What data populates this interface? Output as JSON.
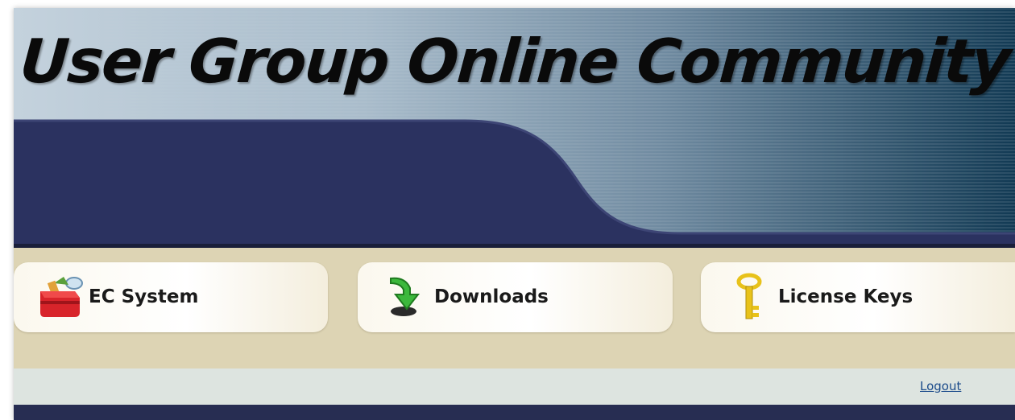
{
  "banner": {
    "title": "User Group Online Community"
  },
  "nav": {
    "items": [
      {
        "label": "EC System",
        "icon": "toolbox-icon"
      },
      {
        "label": "Downloads",
        "icon": "download-arrow-icon"
      },
      {
        "label": "License Keys",
        "icon": "key-icon"
      }
    ]
  },
  "toolbar": {
    "logout_label": "Logout"
  },
  "colors": {
    "banner_dark": "#2b3260",
    "nav_background": "#ddd4b4",
    "toolbar_background": "#dde4e0",
    "link": "#1a4a8a"
  }
}
